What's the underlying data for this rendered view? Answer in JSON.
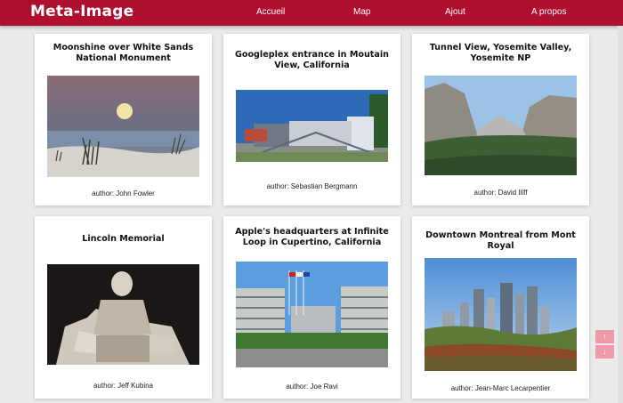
{
  "header": {
    "brand": "Meta-Image",
    "nav": [
      "Accueil",
      "Map",
      "Ajout",
      "A propos"
    ]
  },
  "cards": [
    {
      "title": "Moonshine over White Sands National Monument",
      "author": "author: John Fowler"
    },
    {
      "title": "Googleplex entrance in Moutain View, California",
      "author": "author: Sebastian Bergmann"
    },
    {
      "title": "Tunnel View, Yosemite Valley, Yosemite NP",
      "author": "author: David Iliff"
    },
    {
      "title": "Lincoln Memorial",
      "author": "author: Jeff Kubina"
    },
    {
      "title": "Apple's headquarters at Infinite Loop in Cupertino, California",
      "author": "author: Joe Ravi"
    },
    {
      "title": "Downtown Montreal from Mont Royal",
      "author": "author: Jean-Marc Lecarpentier"
    }
  ],
  "scroll": {
    "up_icon": "arrow-up-icon",
    "up": "↑",
    "down_icon": "arrow-down-icon",
    "down": "↓"
  },
  "colors": {
    "navbar": "#b0102f",
    "scroll_buttons": "#ee9aaa",
    "background": "#ebebeb"
  }
}
